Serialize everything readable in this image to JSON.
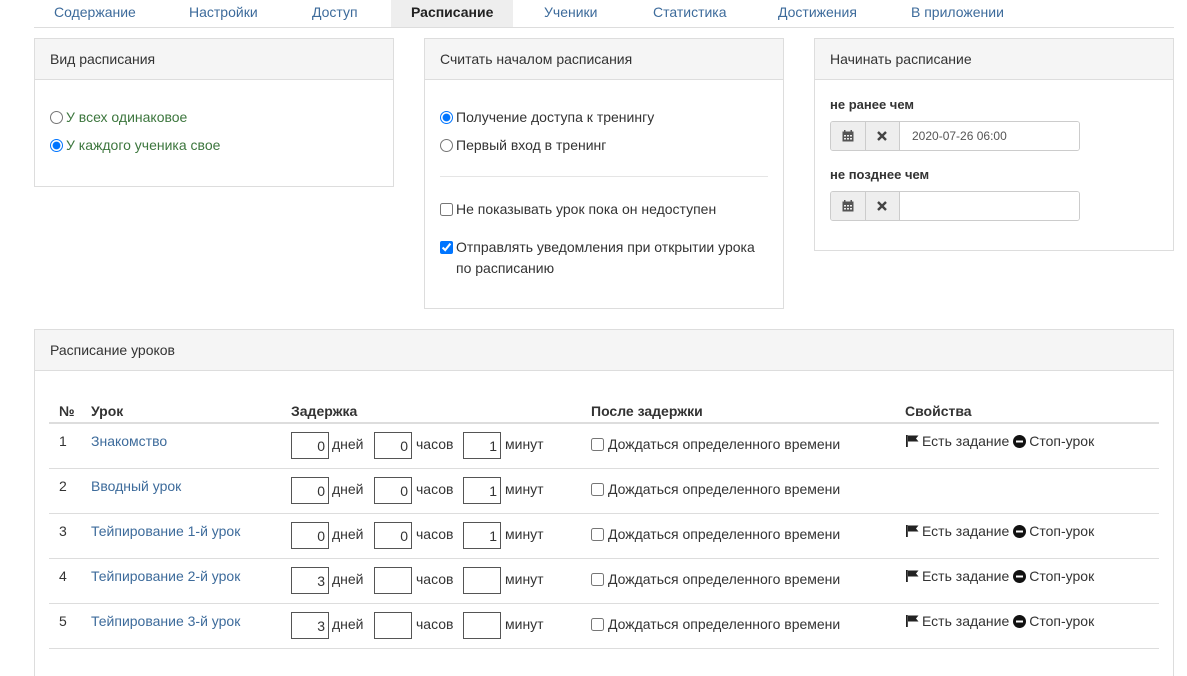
{
  "tabs": [
    {
      "label": "Содержание"
    },
    {
      "label": "Настройки"
    },
    {
      "label": "Доступ"
    },
    {
      "label": "Расписание"
    },
    {
      "label": "Ученики"
    },
    {
      "label": "Статистика"
    },
    {
      "label": "Достижения"
    },
    {
      "label": "В приложении"
    }
  ],
  "active_tab": "Расписание",
  "schedule_type": {
    "title": "Вид расписания",
    "options": [
      {
        "label": "У всех одинаковое",
        "checked": false
      },
      {
        "label": "У каждого ученика свое",
        "checked": true
      }
    ]
  },
  "start_point": {
    "title": "Считать началом расписания",
    "options": [
      {
        "label": "Получение доступа к тренингу",
        "checked": true
      },
      {
        "label": "Первый вход в тренинг",
        "checked": false
      }
    ],
    "checkboxes": [
      {
        "label": "Не показывать урок пока он недоступен",
        "checked": false
      },
      {
        "label": "Отправлять уведомления при открытии урока по расписанию",
        "checked": true
      }
    ]
  },
  "start_dates": {
    "title": "Начинать расписание",
    "not_before_label": "не ранее чем",
    "not_before_value": "2020-07-26 06:00",
    "not_after_label": "не позднее чем",
    "not_after_value": "",
    "calendar_icon": "calendar-icon",
    "clear_icon": "times-icon"
  },
  "lessons": {
    "title": "Расписание уроков",
    "headers": {
      "num": "№",
      "lesson": "Урок",
      "delay": "Задержка",
      "after": "После задержки",
      "props": "Свойства"
    },
    "units": {
      "days": "дней",
      "hours": "часов",
      "minutes": "минут"
    },
    "wait_label": "Дождаться определенного времени",
    "prop_task": "Есть задание",
    "prop_stop": "Стоп-урок",
    "rows": [
      {
        "num": "1",
        "name": "Знакомство",
        "days": "0",
        "hours": "0",
        "minutes": "1",
        "wait": false,
        "has_task": true,
        "stop": true
      },
      {
        "num": "2",
        "name": "Вводный урок",
        "days": "0",
        "hours": "0",
        "minutes": "1",
        "wait": false,
        "has_task": false,
        "stop": false
      },
      {
        "num": "3",
        "name": "Тейпирование 1-й урок",
        "days": "0",
        "hours": "0",
        "minutes": "1",
        "wait": false,
        "has_task": true,
        "stop": true
      },
      {
        "num": "4",
        "name": "Тейпирование 2-й урок",
        "days": "3",
        "hours": "",
        "minutes": "",
        "wait": false,
        "has_task": true,
        "stop": true
      },
      {
        "num": "5",
        "name": "Тейпирование 3-й урок",
        "days": "3",
        "hours": "",
        "minutes": "",
        "wait": false,
        "has_task": true,
        "stop": true
      }
    ]
  },
  "colors": {
    "link": "#3d6b9b",
    "radio_label_green": "#3c763d",
    "panel_heading_bg": "#f5f5f5",
    "border": "#dddddd"
  }
}
